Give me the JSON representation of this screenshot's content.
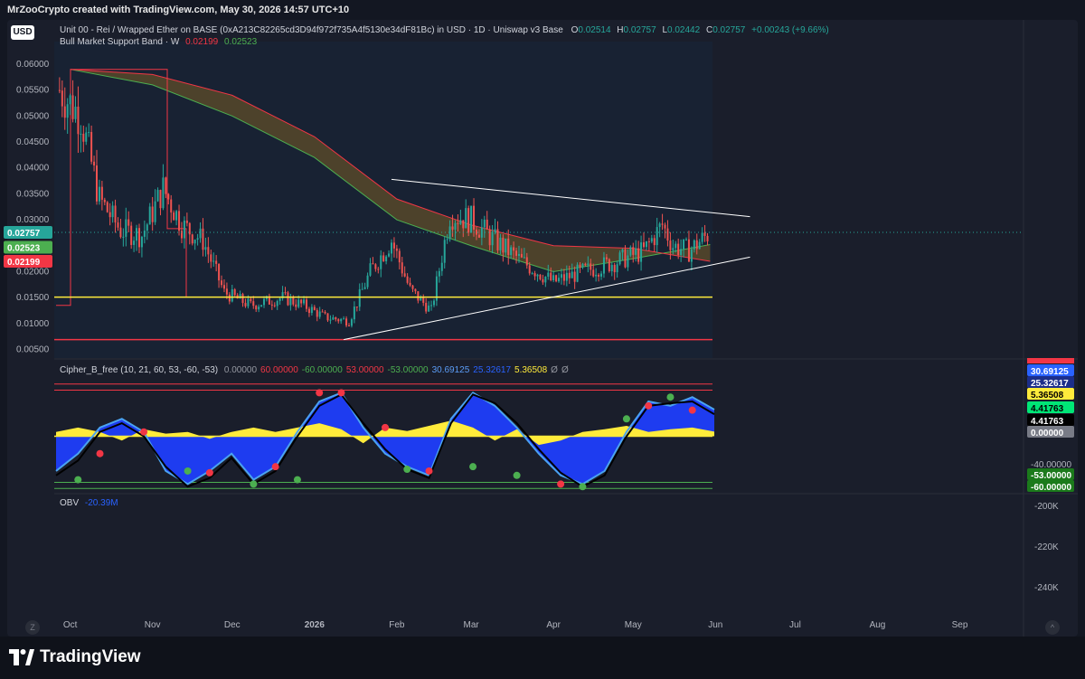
{
  "header": {
    "title": "MrZooCrypto created with TradingView.com, May 30, 2026 14:57 UTC+10"
  },
  "currency_button": "USD",
  "main_legend": {
    "symbol": "Unit 00 - Rei / Wrapped Ether on BASE (0xA213C82265cd3D94f972f735A4f5130e34dF81Bc) in USD · 1D · Uniswap v3 Base",
    "o_label": "O",
    "o_value": "0.02514",
    "h_label": "H",
    "h_value": "0.02757",
    "l_label": "L",
    "l_value": "0.02442",
    "c_label": "C",
    "c_value": "0.02757",
    "change": "+0.00243 (+9.66%)"
  },
  "band_legend": {
    "name": "Bull Market Support Band · W",
    "v1": "0.02199",
    "v2": "0.02523"
  },
  "cipher_legend": {
    "name": "Cipher_B_free (10, 21, 60, 53, -60, -53)",
    "values": [
      "0.00000",
      "60.00000",
      "-60.00000",
      "53.00000",
      "-53.00000",
      "30.69125",
      "25.32617",
      "5.36508",
      "Ø",
      "Ø"
    ],
    "colors": [
      "#9598a1",
      "#f23645",
      "#4caf50",
      "#f23645",
      "#4caf50",
      "#5b9cf6",
      "#2962ff",
      "#ffeb3b",
      "#9598a1",
      "#9598a1"
    ]
  },
  "obv_legend": {
    "name": "OBV",
    "value": "-20.39M"
  },
  "price_axis": {
    "ticks": [
      "0.06000",
      "0.05500",
      "0.05000",
      "0.04500",
      "0.04000",
      "0.03500",
      "0.03000",
      "0.02500",
      "0.02000",
      "0.01500",
      "0.01000",
      "0.00500"
    ],
    "labels": [
      {
        "text": "0.02757",
        "color": "#26a69a"
      },
      {
        "text": "0.02523",
        "color": "#4caf50"
      },
      {
        "text": "0.02199",
        "color": "#f23645"
      }
    ]
  },
  "cipher_axis": {
    "labels": [
      {
        "text": "30.69125",
        "color": "#2962ff"
      },
      {
        "text": "25.32617",
        "color": "#1c2e8a"
      },
      {
        "text": "5.36508",
        "color": "#ffeb3b"
      },
      {
        "text": "4.41763",
        "color": "#00e676"
      },
      {
        "text": "4.41763",
        "color": "#000000"
      },
      {
        "text": "0.00000",
        "color": "#787b86"
      },
      {
        "text": "-40.00000",
        "color": "none"
      },
      {
        "text": "-53.00000",
        "color": "#1b7a1b"
      },
      {
        "text": "-60.00000",
        "color": "#1b7a1b"
      }
    ]
  },
  "obv_axis": {
    "ticks": [
      "-200K",
      "-220K",
      "-240K"
    ]
  },
  "time_axis": {
    "ticks": [
      "Oct",
      "Nov",
      "Dec",
      "2026",
      "Feb",
      "Mar",
      "Apr",
      "May",
      "Jun",
      "Jul",
      "Aug",
      "Sep"
    ]
  },
  "brand": {
    "name": "TradingView"
  },
  "colors": {
    "background": "#131722",
    "up": "#26a69a",
    "down": "#ef5350",
    "support": "#ffeb3b",
    "bottom_line": "#f23645",
    "trendline": "#ffffff",
    "band_fill": "#8b6a2b"
  },
  "chart_data": [
    {
      "type": "candlestick",
      "title": "",
      "ylim": [
        0.003,
        0.064
      ],
      "x_range": [
        "2025-09-25",
        "2026-09-25"
      ],
      "key_levels": {
        "horizontal_support": 0.0151,
        "horizontal_bottom": 0.0069,
        "upper_trendline": [
          [
            "2026-01-30",
            0.0378
          ],
          [
            "2026-06-14",
            0.0306
          ]
        ],
        "lower_trendline": [
          [
            "2026-01-12",
            0.0069
          ],
          [
            "2026-06-14",
            0.0228
          ]
        ]
      },
      "closes_approx": [
        [
          "2025-09-27",
          0.055
        ],
        [
          "2025-10-05",
          0.05
        ],
        [
          "2025-10-12",
          0.034
        ],
        [
          "2025-10-20",
          0.028
        ],
        [
          "2025-10-28",
          0.027
        ],
        [
          "2025-11-05",
          0.036
        ],
        [
          "2025-11-12",
          0.029
        ],
        [
          "2025-11-20",
          0.026
        ],
        [
          "2025-11-28",
          0.016
        ],
        [
          "2025-12-08",
          0.0135
        ],
        [
          "2025-12-20",
          0.015
        ],
        [
          "2025-12-28",
          0.0135
        ],
        [
          "2026-01-05",
          0.0112
        ],
        [
          "2026-01-14",
          0.0105
        ],
        [
          "2026-01-22",
          0.02
        ],
        [
          "2026-01-30",
          0.026
        ],
        [
          "2026-02-06",
          0.0165
        ],
        [
          "2026-02-14",
          0.0125
        ],
        [
          "2026-02-21",
          0.031
        ],
        [
          "2026-03-01",
          0.03
        ],
        [
          "2026-03-10",
          0.026
        ],
        [
          "2026-03-20",
          0.022
        ],
        [
          "2026-04-01",
          0.018
        ],
        [
          "2026-04-12",
          0.02
        ],
        [
          "2026-04-25",
          0.022
        ],
        [
          "2026-05-05",
          0.024
        ],
        [
          "2026-05-12",
          0.029
        ],
        [
          "2026-05-16",
          0.025
        ],
        [
          "2026-05-22",
          0.024
        ],
        [
          "2026-05-30",
          0.02757
        ]
      ],
      "bull_market_support_band": {
        "line1": [
          [
            "2025-10-01",
            0.059
          ],
          [
            "2025-11-01",
            0.056
          ],
          [
            "2025-12-01",
            0.05
          ],
          [
            "2026-01-01",
            0.042
          ],
          [
            "2026-02-01",
            0.03
          ],
          [
            "2026-03-01",
            0.025
          ],
          [
            "2026-04-01",
            0.02
          ],
          [
            "2026-05-01",
            0.0225
          ],
          [
            "2026-05-30",
            0.02523
          ]
        ],
        "line2": [
          [
            "2025-10-01",
            0.059
          ],
          [
            "2025-11-01",
            0.058
          ],
          [
            "2025-12-01",
            0.054
          ],
          [
            "2026-01-01",
            0.046
          ],
          [
            "2026-02-01",
            0.034
          ],
          [
            "2026-03-01",
            0.029
          ],
          [
            "2026-04-01",
            0.025
          ],
          [
            "2026-05-01",
            0.0245
          ],
          [
            "2026-05-30",
            0.02199
          ]
        ]
      },
      "series": [
        {
          "name": "Bull Market Support Band",
          "values": [
            0.02199,
            0.02523
          ]
        }
      ]
    },
    {
      "type": "area",
      "title": "Cipher_B_free (10, 21, 60, 53, -60, -53)",
      "ylim": [
        -65,
        65
      ],
      "levels": [
        60,
        53,
        -53,
        -60
      ],
      "series": [
        {
          "name": "wave1",
          "values": [
            -40,
            -20,
            10,
            20,
            5,
            -40,
            -55,
            -40,
            -20,
            -50,
            -35,
            5,
            40,
            50,
            10,
            -20,
            -35,
            -45,
            20,
            50,
            35,
            10,
            -20,
            -45,
            -55,
            -40,
            5,
            40,
            35,
            45,
            30.69125
          ]
        },
        {
          "name": "wave2",
          "values": [
            -45,
            -28,
            5,
            15,
            0,
            -35,
            -58,
            -48,
            -25,
            -55,
            -40,
            0,
            35,
            48,
            15,
            -15,
            -38,
            -48,
            15,
            48,
            38,
            15,
            -15,
            -42,
            -58,
            -45,
            0,
            35,
            38,
            40,
            25.32617
          ]
        },
        {
          "name": "mfi",
          "values": [
            5,
            10,
            5,
            -5,
            8,
            3,
            5,
            -3,
            5,
            10,
            5,
            10,
            15,
            8,
            -8,
            10,
            6,
            12,
            18,
            10,
            -5,
            8,
            -10,
            -5,
            5,
            8,
            12,
            5,
            8,
            10,
            5.36508
          ]
        }
      ],
      "dots": {
        "red": [
          -20,
          5,
          -42,
          -35,
          50,
          50,
          10,
          -40,
          -55,
          35,
          30
        ],
        "green": [
          -50,
          -40,
          -55,
          -50,
          -38,
          -35,
          -45,
          -58,
          20,
          45
        ]
      }
    },
    {
      "type": "line",
      "title": "OBV",
      "value": "-20.39M",
      "ticks": [
        "-200K",
        "-220K",
        "-240K"
      ]
    }
  ]
}
